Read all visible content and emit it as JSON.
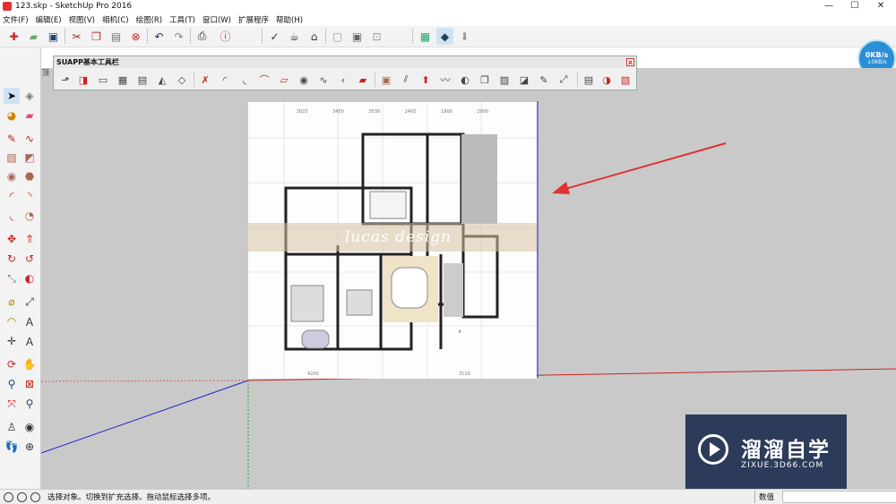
{
  "window": {
    "title": "123.skp - SketchUp Pro 2016",
    "minimize": "—",
    "maximize": "☐",
    "close": "✕"
  },
  "menu": [
    "文件(F)",
    "编辑(E)",
    "视图(V)",
    "相机(C)",
    "绘图(R)",
    "工具(T)",
    "窗口(W)",
    "扩展程序",
    "帮助(H)"
  ],
  "viewport": {
    "tab_label": "顶"
  },
  "suapp": {
    "title": "SUAPP基本工具栏",
    "close": "x"
  },
  "plan": {
    "watermark": "lucas design",
    "top_dims": [
      "3025",
      "3450",
      "3530",
      "2400",
      "1900",
      "2900"
    ],
    "bottom_dims": [
      "4200",
      "3110"
    ]
  },
  "net_badge": {
    "up": "0KB/s",
    "down": "↓0KB/s"
  },
  "logo": {
    "name": "溜溜自学",
    "url": "ZIXUE.3D66.COM"
  },
  "status": {
    "message": "选择对象。切换到扩充选择。拖动鼠标选择多项。",
    "vcb_label": "数值"
  }
}
